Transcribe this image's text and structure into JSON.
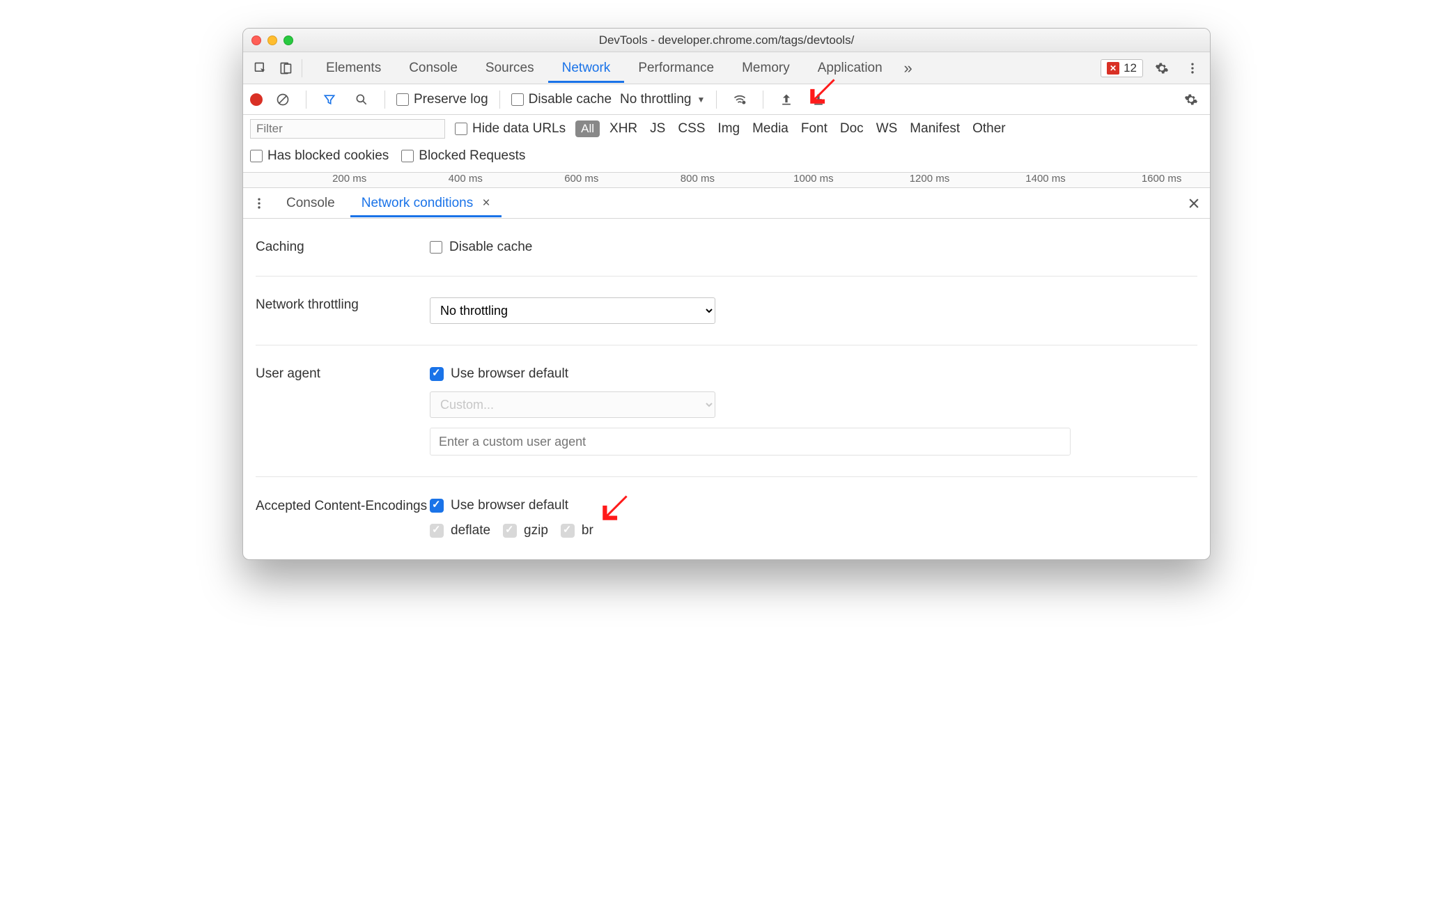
{
  "title": "DevTools - developer.chrome.com/tags/devtools/",
  "tabs": [
    "Elements",
    "Console",
    "Sources",
    "Network",
    "Performance",
    "Memory",
    "Application"
  ],
  "active_tab": "Network",
  "error_count": "12",
  "toolbar": {
    "preserve_log": "Preserve log",
    "disable_cache": "Disable cache",
    "throttling": "No throttling"
  },
  "filter": {
    "placeholder": "Filter",
    "hide_data_urls": "Hide data URLs",
    "all": "All",
    "types": [
      "XHR",
      "JS",
      "CSS",
      "Img",
      "Media",
      "Font",
      "Doc",
      "WS",
      "Manifest",
      "Other"
    ],
    "has_blocked": "Has blocked cookies",
    "blocked_requests": "Blocked Requests"
  },
  "timeline": [
    "200 ms",
    "400 ms",
    "600 ms",
    "800 ms",
    "1000 ms",
    "1200 ms",
    "1400 ms",
    "1600 ms"
  ],
  "drawer": {
    "tabs": [
      "Console",
      "Network conditions"
    ],
    "active": "Network conditions"
  },
  "netcond": {
    "caching": {
      "label": "Caching",
      "disable_cache": "Disable cache"
    },
    "throttling": {
      "label": "Network throttling",
      "value": "No throttling"
    },
    "user_agent": {
      "label": "User agent",
      "use_default": "Use browser default",
      "custom": "Custom...",
      "placeholder": "Enter a custom user agent"
    },
    "encodings": {
      "label": "Accepted Content-Encodings",
      "use_default": "Use browser default",
      "opts": [
        "deflate",
        "gzip",
        "br"
      ]
    }
  }
}
